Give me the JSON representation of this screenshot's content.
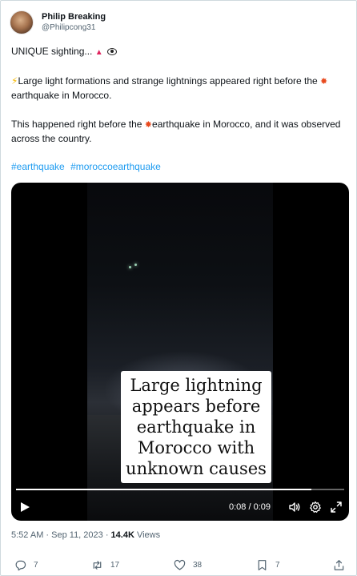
{
  "author": {
    "display_name": "Philip Breaking",
    "handle": "@Philipcong31"
  },
  "tweet": {
    "line1_text": "UNIQUE sighting...",
    "line2_text": "Large light formations and strange lightnings appeared right before the",
    "line2_tail": "earthquake in Morocco.",
    "line3_a": "This happened right before the",
    "line3_b": "earthquake in Morocco, and it was observed across the country.",
    "hashtags": [
      "#earthquake",
      "#moroccoearthquake"
    ]
  },
  "video": {
    "caption": "Large lightning appears before earthquake in Morocco with unknown causes",
    "time_display": "0:08 / 0:09",
    "progress": 0.9
  },
  "meta": {
    "timestamp": "5:52 AM · Sep 11, 2023 · ",
    "views_count": "14.4K",
    "views_label": "Views"
  },
  "actions": {
    "replies": "7",
    "reposts": "17",
    "likes": "38",
    "bookmarks": "7"
  },
  "colors": {
    "link": "#1d9bf0",
    "secondary_text": "#536471",
    "primary_text": "#0f1419"
  },
  "icons": {
    "reply": "reply-icon",
    "repost": "repost-icon",
    "like": "heart-icon",
    "bookmark": "bookmark-icon",
    "share": "share-icon",
    "play": "play-icon",
    "volume": "volume-icon",
    "settings": "gear-icon",
    "fullscreen": "fullscreen-icon"
  }
}
